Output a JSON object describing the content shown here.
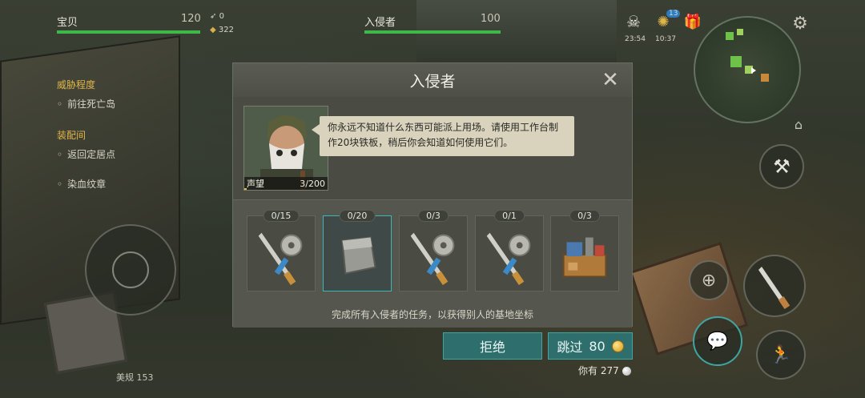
{
  "hud": {
    "player_name": "宝贝",
    "player_hp": "120",
    "kills": "0",
    "resource": "322",
    "enemy_name": "入侵者",
    "enemy_hp": "100",
    "timer_left": "23:54",
    "timer_right": "10:37",
    "notification_count": "13"
  },
  "quests": {
    "threat_heading": "威胁程度",
    "threat_item": "前往死亡岛",
    "equip_heading": "装配间",
    "equip_item": "返回定居点",
    "blood_item": "染血纹章"
  },
  "dialog": {
    "title": "入侵者",
    "speech": "你永远不知道什么东西可能派上用场。请使用工作台制作20块铁板，稍后你会知道如何使用它们。",
    "reputation_label": "声望",
    "reputation_value": "3/200",
    "tasks": [
      {
        "count": "0/15",
        "icon": "machete-sawblade-icon"
      },
      {
        "count": "0/20",
        "icon": "iron-plate-icon"
      },
      {
        "count": "0/3",
        "icon": "machete-sawblade-icon"
      },
      {
        "count": "0/1",
        "icon": "machete-sawblade-icon"
      },
      {
        "count": "0/3",
        "icon": "workbench-icon"
      }
    ],
    "footer_note": "完成所有入侵者的任务，以获得别人的基地坐标"
  },
  "actions": {
    "reject_label": "拒绝",
    "skip_label": "跳过",
    "skip_cost": "80",
    "have_label": "你有 277"
  },
  "bottom": {
    "label": "美规 153"
  },
  "colors": {
    "accent_teal": "#3ea6a2",
    "hp_green": "#3fb84a",
    "quest_gold": "#e0b64a",
    "speech_bg": "#d9d3bd"
  }
}
